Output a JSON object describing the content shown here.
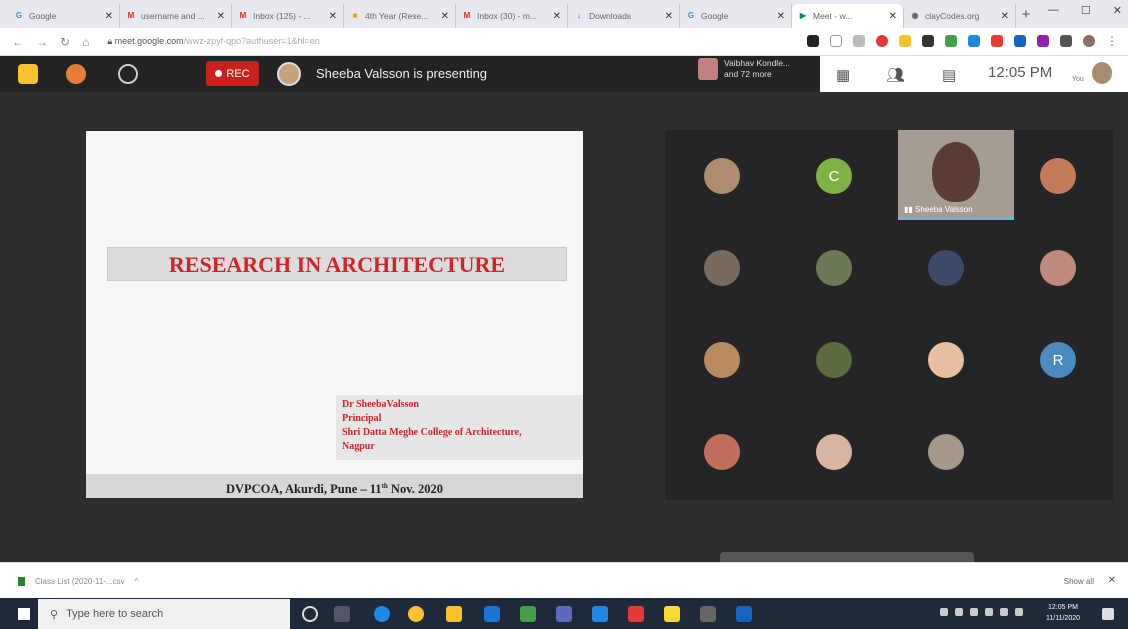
{
  "browser": {
    "tabs": [
      {
        "title": "Google",
        "icon": "google-icon",
        "color": "#4285f4",
        "glyph": "G"
      },
      {
        "title": "username and ...",
        "icon": "gmail-icon",
        "color": "#d93025",
        "glyph": "M"
      },
      {
        "title": "Inbox (125) - ...",
        "icon": "gmail-icon",
        "color": "#d93025",
        "glyph": "M"
      },
      {
        "title": "4th Year (Rese...",
        "icon": "slides-icon",
        "color": "#f29900",
        "glyph": "■"
      },
      {
        "title": "Inbox (30) - m...",
        "icon": "gmail-icon",
        "color": "#d93025",
        "glyph": "M"
      },
      {
        "title": "Downloads",
        "icon": "download-icon",
        "color": "#1a73e8",
        "glyph": "↓"
      },
      {
        "title": "Google",
        "icon": "google-icon",
        "color": "#4285f4",
        "glyph": "G"
      },
      {
        "title": "Meet - w...",
        "icon": "meet-icon",
        "color": "#00897b",
        "glyph": "▶"
      },
      {
        "title": "clayCodes.org",
        "icon": "web-icon",
        "color": "#666666",
        "glyph": "◉"
      }
    ],
    "url_host": "meet.google.com",
    "url_path": "/wwz-zpyf-qpo?authuser=1&hl=en"
  },
  "meet": {
    "rec_label": "REC",
    "presenting_text": "Sheeba Valsson is presenting",
    "participants_text_line1": "Vaibhav Kondle...",
    "participants_text_line2": "and 72 more",
    "time": "12:05 PM",
    "you_label": "You",
    "camera_name": "Sheeba Valsson",
    "grid": [
      {
        "initial": "",
        "color": "#b08c6e"
      },
      {
        "initial": "C",
        "color": "#7cb342"
      },
      {
        "initial": "",
        "color": "#c27c5a"
      },
      {
        "initial": "",
        "color": "#7a6a5e"
      },
      {
        "initial": "",
        "color": "#6b7a55"
      },
      {
        "initial": "",
        "color": "#3b4a6b"
      },
      {
        "initial": "",
        "color": "#c08a7a"
      },
      {
        "initial": "",
        "color": "#b98a5f"
      },
      {
        "initial": "",
        "color": "#5a6b3e"
      },
      {
        "initial": "",
        "color": "#e8c0a0"
      },
      {
        "initial": "R",
        "color": "#4b8bbe"
      },
      {
        "initial": "",
        "color": "#c0705a"
      },
      {
        "initial": "",
        "color": "#d8b5a0"
      },
      {
        "initial": "",
        "color": "#a59888"
      }
    ]
  },
  "slide": {
    "title": "RESEARCH IN ARCHITECTURE",
    "author_line1": "Dr SheebaValsson",
    "author_line2": "Principal",
    "author_line3": "Shri Datta Meghe College of Architecture,",
    "author_line4": "Nagpur",
    "footer_pre": "DVPCOA, Akurdi, Pune – 11",
    "footer_sup": "th",
    "footer_post": " Nov. 2020"
  },
  "downloads": {
    "file_label": "Class List (2020-11-...csv",
    "show_all": "Show all"
  },
  "taskbar": {
    "search_placeholder": "Type here to search",
    "clock_time": "12:05 PM",
    "clock_date": "11/11/2020"
  },
  "colors": {
    "rec": "#c5221f",
    "slide_title": "#d2232a",
    "meet_bg": "#2e2e30",
    "speaking_indicator": "#4fc3c7"
  }
}
